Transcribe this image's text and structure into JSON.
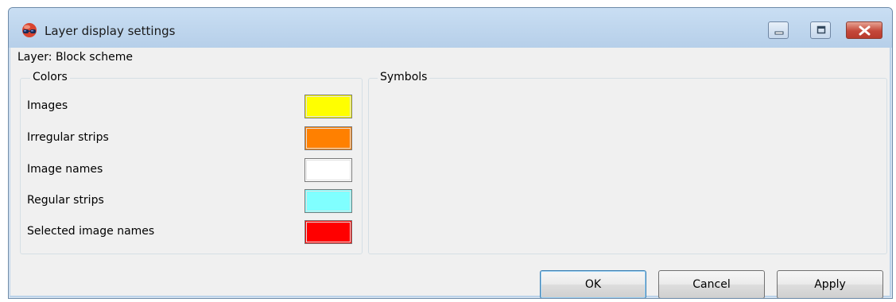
{
  "window": {
    "title": "Layer display settings",
    "icon": "app-globe-glasses-icon"
  },
  "titlebar_buttons": {
    "minimize_icon": "minimize-icon",
    "maximize_icon": "maximize-icon",
    "close_icon": "close-icon"
  },
  "layer": {
    "label": "Layer: Block scheme"
  },
  "colors": {
    "title": "Colors",
    "items": [
      {
        "label": "Images",
        "color": "#ffff00"
      },
      {
        "label": "Irregular strips",
        "color": "#ff8000"
      },
      {
        "label": "Image names",
        "color": "#ffffff"
      },
      {
        "label": "Regular strips",
        "color": "#80ffff"
      },
      {
        "label": "Selected image names",
        "color": "#ff0000"
      }
    ]
  },
  "symbols": {
    "title": "Symbols"
  },
  "buttons": {
    "ok": "OK",
    "cancel": "Cancel",
    "apply": "Apply"
  }
}
